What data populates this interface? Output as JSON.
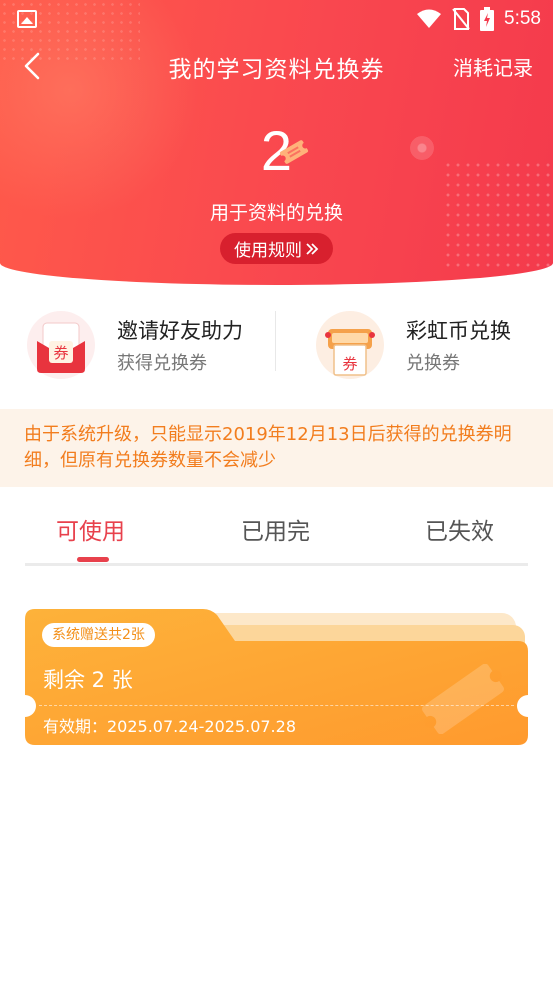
{
  "status_bar": {
    "time": "5:58"
  },
  "header": {
    "title": "我的学习资料兑换券",
    "record_link": "消耗记录",
    "count": "2",
    "subtitle": "用于资料的兑换",
    "rules_button": "使用规则",
    "colors": {
      "gradient_start": "#ff5a4a",
      "gradient_end": "#f43a4c",
      "rules_bg": "#d8202e"
    }
  },
  "entries": [
    {
      "title": "邀请好友助力",
      "sub": "获得兑换券",
      "icon": "invite-coupon-icon",
      "icon_text": "券"
    },
    {
      "title": "彩虹币兑换",
      "sub": "兑换券",
      "icon": "rainbow-coin-coupon-icon",
      "icon_text": "券"
    }
  ],
  "notice": {
    "text": "由于系统升级，只能显示2019年12月13日后获得的兑换券明细，但原有兑换券数量不会减少",
    "color": "#f27d1e"
  },
  "tabs": [
    {
      "label": "可使用",
      "active": true
    },
    {
      "label": "已用完",
      "active": false
    },
    {
      "label": "已失效",
      "active": false
    }
  ],
  "coupons": [
    {
      "badge": "系统赠送共2张",
      "remaining": "剩余 2 张",
      "validity": "有效期：2025.07.24-2025.07.28"
    }
  ],
  "accent": "#e8414c"
}
